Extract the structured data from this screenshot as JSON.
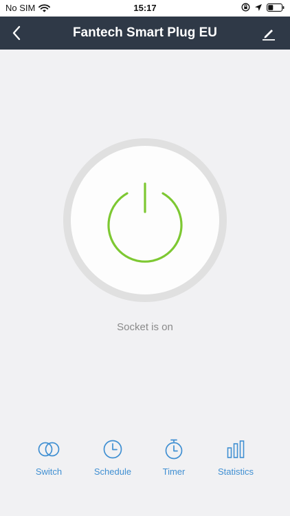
{
  "status_bar": {
    "carrier": "No SIM",
    "time": "15:17"
  },
  "header": {
    "title": "Fantech Smart Plug EU",
    "back_icon": "chevron-left-icon",
    "edit_icon": "pencil-icon"
  },
  "power": {
    "state_text": "Socket is on",
    "icon": "power-icon",
    "color_on": "#7dc832"
  },
  "tabs": [
    {
      "label": "Switch",
      "icon": "switch-icon"
    },
    {
      "label": "Schedule",
      "icon": "clock-icon"
    },
    {
      "label": "Timer",
      "icon": "timer-icon"
    },
    {
      "label": "Statistics",
      "icon": "bar-chart-icon"
    }
  ],
  "colors": {
    "navbar": "#2f3947",
    "accent": "#3f8fd2",
    "background": "#f1f1f3"
  }
}
